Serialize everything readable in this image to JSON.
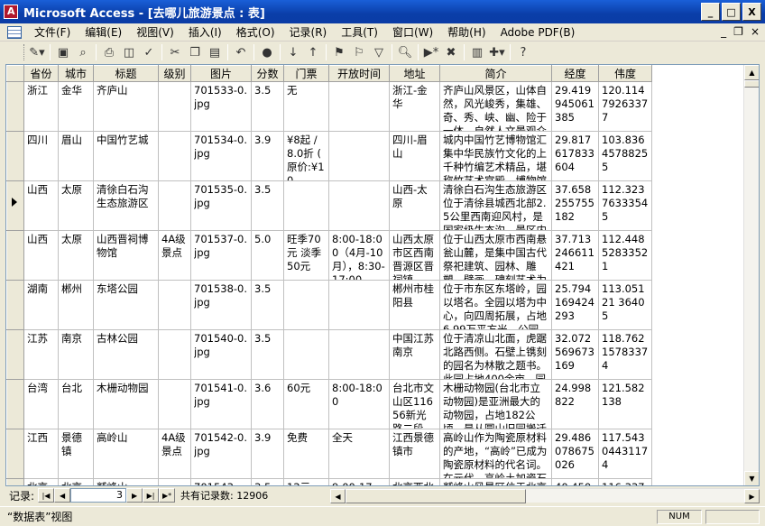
{
  "window": {
    "title": "Microsoft Access - [去哪儿旅游景点 : 表]",
    "minimize": "_",
    "maximize": "□",
    "close": "X"
  },
  "menu": {
    "items": [
      "文件(F)",
      "编辑(E)",
      "视图(V)",
      "插入(I)",
      "格式(O)",
      "记录(R)",
      "工具(T)",
      "窗口(W)",
      "帮助(H)",
      "Adobe PDF(B)"
    ],
    "mdi_min": "_",
    "mdi_restore": "❐",
    "mdi_close": "×"
  },
  "toolbar": {
    "icons": [
      "design-view-icon",
      "save-icon",
      "search-file-icon",
      "print-icon",
      "print-preview-icon",
      "spelling-icon",
      "cut-icon",
      "copy-icon",
      "paste-icon",
      "undo-icon",
      "hyperlink-icon",
      "sort-ascending-icon",
      "sort-descending-icon",
      "filter-by-selection-icon",
      "filter-by-form-icon",
      "apply-filter-icon",
      "find-icon",
      "new-record-icon",
      "delete-record-icon",
      "database-window-icon",
      "new-object-icon",
      "help-icon"
    ]
  },
  "grid": {
    "columns": [
      "省份",
      "城市",
      "标题",
      "级别",
      "图片",
      "分数",
      "门票",
      "开放时间",
      "地址",
      "简介",
      "经度",
      "伟度"
    ],
    "rows": [
      [
        "浙江",
        "金华",
        "齐庐山",
        "",
        "701533-0.jpg",
        "3.5",
        "无",
        "",
        "浙江-金华",
        "齐庐山风景区，山体自然，风光峻秀，集雄、奇、秀、峡、幽、险于一体，自然人文景观众多，气候凉爽宜人，是一避暑休闲、保健疗养的旅游胜地。区内植被茂",
        "29.419945061385",
        "120.11479263377"
      ],
      [
        "四川",
        "眉山",
        "中国竹艺城",
        "",
        "701534-0.jpg",
        "3.9",
        "¥8起 / 8.0折 ( 原价:¥10",
        "",
        "四川-眉山",
        "城内中国竹艺博物馆汇集中华民族竹文化的上千种竹编艺术精品，堪称竹艺术宫殿。博物馆分三个展厅，第一展厅&#34;数说远人物不看今朝&#34;。中国竹艺城",
        "29.817617833604",
        "103.83645788255"
      ],
      [
        "山西",
        "太原",
        "清徐白石沟生态旅游区",
        "",
        "701535-0.jpg",
        "3.5",
        "",
        "",
        "山西-太原",
        "清徐白石沟生态旅游区位于清徐县城西北部2.5公里西南迎风村，是国家级生态沟。景区内山青水秀，鸟果绿延，众多唐宋时期如马鬃寺、文殊祖等古文物建筑上",
        "37.658255755182",
        "112.32376333545"
      ],
      [
        "山西",
        "太原",
        "山西晋祠博物馆",
        "4A级景点",
        "701537-0.jpg",
        "5.0",
        "旺季70元 淡季50元",
        "8:00-18:00（4月-10月），8:30-17:00",
        "山西太原市区西南晋源区晋祠镇",
        "位于山西太原市西南悬瓮山麓，是集中国古代祭祀建筑、园林、雕塑、壁画、碑刻艺术为一体的唯一而珍贵的历史文化遗产，也是世界建筑、园林、雕刻艺术中公",
        "37.713246611421",
        "112.44852833521"
      ],
      [
        "湖南",
        "郴州",
        "东塔公园",
        "",
        "701538-0.jpg",
        "3.5",
        "",
        "",
        "郴州市桂阳县",
        "位于市东区东塔岭，园以塔名。全园以塔为中心，向四周拓展，占地6.99万平方米。公园雄踞城东门户，紧靠人民广场，有百余级石踏道直通公园大门。另有混",
        "25.794169424293",
        "113.05121 36405"
      ],
      [
        "江苏",
        "南京",
        "古林公园",
        "",
        "701540-0.jpg",
        "3.5",
        "",
        "",
        "中国江苏南京",
        "位于清凉山北面，虎踞北路西侧。石壁上镌刻的园名为林散之题书。此园占地400余亩，园内丘陵起伏，高低错落。古林公园建在原古林寺屋宅林遗址上，为纪念",
        "32.072569673169",
        "118.76215783374"
      ],
      [
        "台湾",
        "台北",
        "木栅动物园",
        "",
        "701541-0.jpg",
        "3.6",
        "60元",
        "8:00-18:00",
        "台北市文山区11656新光路二段",
        "木栅动物园(台北市立动物园)是亚洲最大的动物园，占地182公顷。是从圆山旧园搬迁过来的，园内包含13个动物展示区，馆区包括台湾乡土动物区、蝴蝶公",
        "24.998822",
        "121.582138"
      ],
      [
        "江西",
        "景德镇",
        "高岭山",
        "4A级景点",
        "701542-0.jpg",
        "3.9",
        "免费",
        "全天",
        "江西景德镇市",
        "高岭山作为陶瓷原材料的产地，“高岭”已成为陶瓷原材料的代名词。在元代，高岭土加瓷石这种一种二元配方的制瓷工艺的产生，为此后景德镇制瓷业的快速发展",
        "29.486078675026",
        "117.54304431174"
      ],
      [
        "北京",
        "北京",
        "鹫峰山",
        "",
        "701543-",
        "3.5",
        "12元",
        "9:00-17:",
        "北京西北",
        "鹫峰山风景区位于北京西北部山区怀柔县",
        "40.450533",
        "116.33764"
      ]
    ]
  },
  "navigation": {
    "label": "记录:",
    "current_record": "3",
    "total_label": "共有记录数: 12906",
    "first": "|◀",
    "prev": "◀",
    "next": "▶",
    "last": "▶|",
    "new": "▶*"
  },
  "status": {
    "view": "“数据表”视图",
    "num": "NUM"
  }
}
